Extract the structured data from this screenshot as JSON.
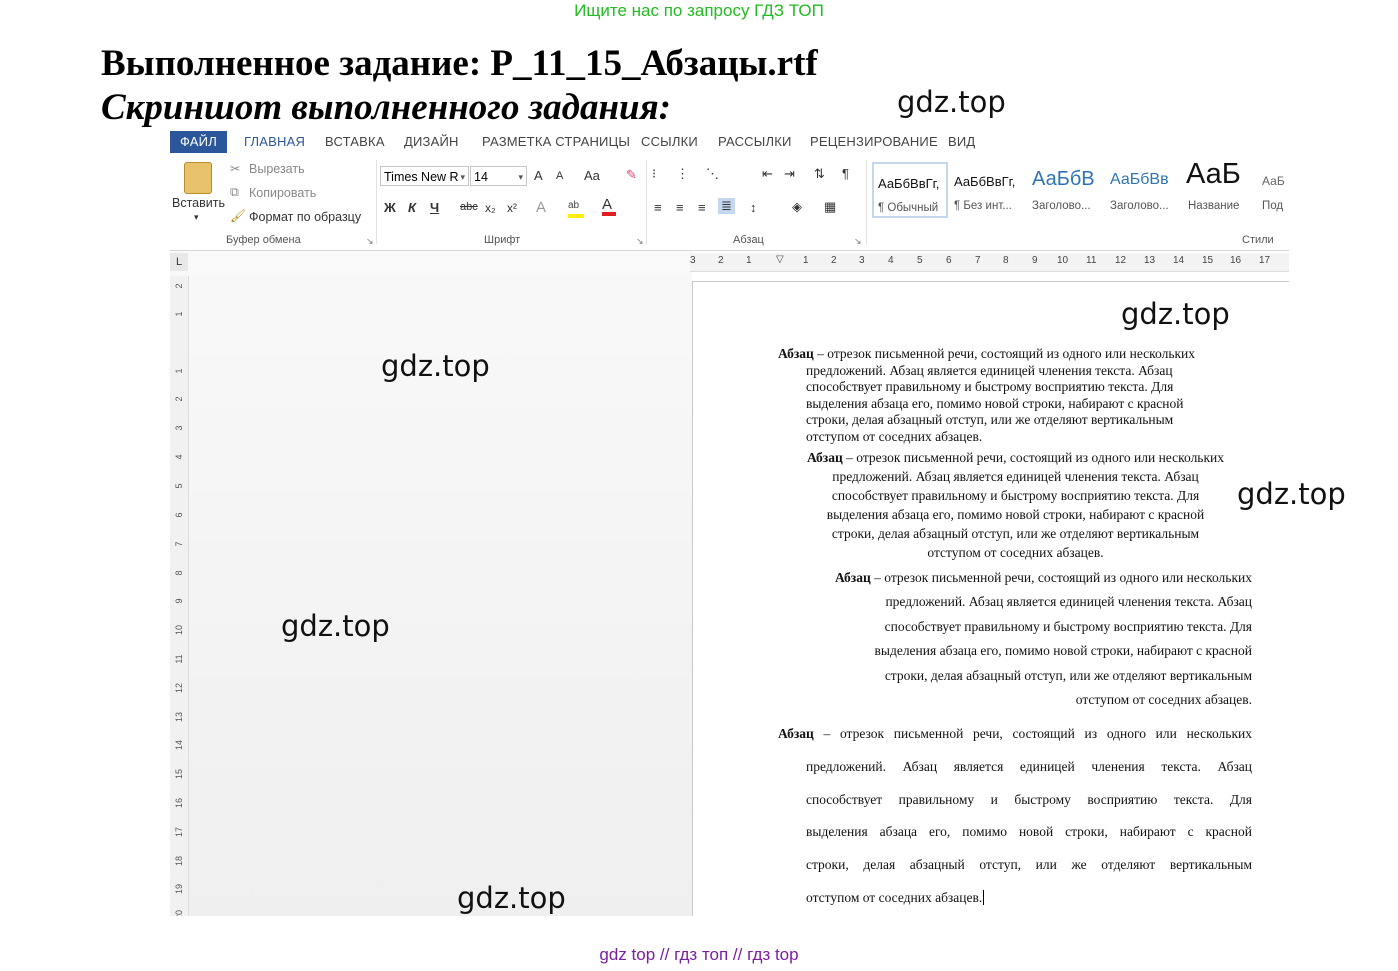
{
  "banner": "Ищите нас по запросу ГДЗ ТОП",
  "heading": "Выполненное задание: P_11_15_Абзацы.rtf",
  "subheading": "Скриншот выполненного задания:",
  "watermark": "gdz.top",
  "footer": "gdz top  //  гдз топ  //  гдз top",
  "word": {
    "tabs": [
      "ФАЙЛ",
      "ГЛАВНАЯ",
      "ВСТАВКА",
      "ДИЗАЙН",
      "РАЗМЕТКА СТРАНИЦЫ",
      "ССЫЛКИ",
      "РАССЫЛКИ",
      "РЕЦЕНЗИРОВАНИЕ",
      "ВИД"
    ],
    "clipboard": {
      "paste": "Вставить",
      "cut": "Вырезать",
      "copy": "Копировать",
      "format_painter": "Формат по образцу",
      "label": "Буфер обмена"
    },
    "font": {
      "name": "Times New R",
      "size": "14",
      "label": "Шрифт",
      "bold": "Ж",
      "italic": "К",
      "underline": "Ч",
      "strike": "abc",
      "sub": "x₂",
      "sup": "x²",
      "grow": "A",
      "shrink": "A",
      "case": "Aa"
    },
    "paragraph_label": "Абзац",
    "styles_label": "Стили",
    "styles": [
      {
        "sample": "АаБбВвГг,",
        "name": "¶ Обычный"
      },
      {
        "sample": "АаБбВвГг,",
        "name": "¶ Без инт..."
      },
      {
        "sample": "АаБбВ",
        "name": "Заголово..."
      },
      {
        "sample": "АаБбВв",
        "name": "Заголово..."
      },
      {
        "sample": "АаБ",
        "name": "Название"
      },
      {
        "sample": "АаБ",
        "name": "Под"
      }
    ],
    "ruler_corner": "L",
    "hruler_ticks": [
      "3",
      "2",
      "1",
      "1",
      "2",
      "3",
      "4",
      "5",
      "6",
      "7",
      "8",
      "9",
      "10",
      "11",
      "12",
      "13",
      "14",
      "15",
      "16",
      "17"
    ],
    "vruler_ticks": [
      "2",
      "1",
      "1",
      "2",
      "3",
      "4",
      "5",
      "6",
      "7",
      "8",
      "9",
      "10",
      "11",
      "12",
      "13",
      "14",
      "15",
      "16",
      "17",
      "18",
      "19",
      "20"
    ],
    "document": {
      "term": "Абзац",
      "text": " – отрезок письменной речи, состоящий из одного или нескольких предложений. Абзац является единицей членения текста. Абзац способствует правильному и быстрому восприятию текста. Для выделения абзаца его, помимо новой строки, набирают с красной строки, делая абзацный отступ, или же отделяют вертикальным отступом от соседних абзацев.",
      "p1": [
        "Абзац – отрезок письменной речи, состоящий из одного или нескольких",
        "предложений. Абзац является единицей членения текста. Абзац",
        "способствует правильному и быстрому восприятию текста. Для",
        "выделения абзаца его, помимо новой строки, набирают с красной",
        "строки, делая абзацный отступ, или же отделяют вертикальным",
        "отступом от соседних абзацев."
      ],
      "p2": [
        "Абзац – отрезок письменной речи, состоящий из одного или нескольких",
        "предложений. Абзац является единицей членения текста. Абзац",
        "способствует правильному и быстрому восприятию текста. Для",
        "выделения абзаца его, помимо новой строки, набирают с красной",
        "строки, делая абзацный отступ, или же отделяют вертикальным",
        "отступом от соседних абзацев."
      ],
      "p3": [
        "Абзац – отрезок письменной речи, состоящий из одного или нескольких",
        "предложений. Абзац является единицей членения текста. Абзац",
        "способствует правильному и быстрому восприятию текста. Для",
        "выделения абзаца его, помимо новой строки, набирают с красной",
        "строки, делая абзацный отступ, или же отделяют вертикальным",
        "отступом от соседних абзацев."
      ],
      "p4": [
        "Абзац – отрезок письменной речи, состоящий из одного или нескольких",
        "предложений. Абзац является единицей членения текста. Абзац",
        "способствует правильному и быстрому восприятию текста. Для",
        "выделения абзаца его, помимо новой строки, набирают с красной",
        "строки, делая абзацный отступ, или же отделяют вертикальным",
        "отступом от соседних абзацев."
      ]
    }
  },
  "colors": {
    "banner": "#22bb22",
    "file_tab": "#2b579a",
    "footer": "#7a1fa2"
  }
}
